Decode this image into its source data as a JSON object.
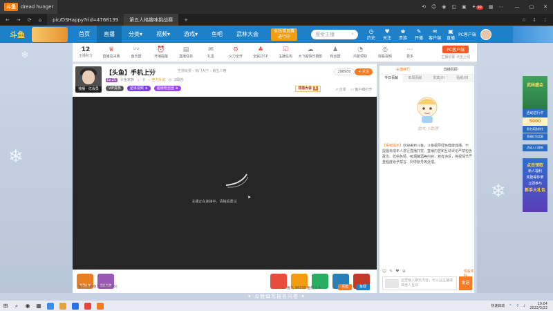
{
  "browser": {
    "tab_logo": "斗鱼",
    "tab_title": "dread hunger",
    "url_text": "pic/DSHappy?rid=4768139",
    "tab2_title": "第五人格趣味挑战赛",
    "nav_icons": [
      "←",
      "→",
      "⟳",
      "⌂"
    ],
    "top_icons": [
      "⟲",
      "☺",
      "◉",
      "◫",
      "▣",
      "✦",
      "▦",
      "⋯"
    ],
    "top_badge": "99",
    "win_controls": [
      "—",
      "▢",
      "✕"
    ],
    "addr_icons": [
      "☆",
      "⇩",
      "⋮"
    ]
  },
  "site": {
    "logo": "斗鱼",
    "menu": [
      "首页",
      "直播",
      "分类▾",
      "视频▾",
      "游戏▾",
      "鱼吧",
      "武林大会"
    ],
    "active_menu_index": 1,
    "promo": "全站首页赛",
    "promo_sub": "进行中",
    "search_placeholder": "搜索主播",
    "search_icon": "⌕",
    "icons": [
      {
        "glyph": "◷",
        "label": "历史"
      },
      {
        "glyph": "♥",
        "label": "关注"
      },
      {
        "glyph": "♚",
        "label": "贵族"
      },
      {
        "glyph": "✎",
        "label": "开播"
      },
      {
        "glyph": "✉",
        "label": "客户端"
      },
      {
        "glyph": "▣",
        "label": "直播"
      }
    ],
    "pc_client": "PC客户端"
  },
  "toolbar": {
    "count": "12",
    "count_label": "主播积分",
    "items": [
      {
        "glyph": "♛",
        "label": "直播总决赛"
      },
      {
        "glyph": "〰",
        "label": "鱼乐团"
      },
      {
        "glyph": "⏰",
        "label": "开播提醒"
      },
      {
        "glyph": "▤",
        "label": "直播任务"
      },
      {
        "glyph": "✉",
        "label": "礼盒"
      },
      {
        "glyph": "⚙",
        "label": "火力全开"
      },
      {
        "glyph": "♣",
        "label": "全民打CP"
      },
      {
        "glyph": "☑",
        "label": "主播任务"
      },
      {
        "glyph": "☁",
        "label": "大飞船快乐摄影"
      },
      {
        "glyph": "♟",
        "label": "粉丝团"
      },
      {
        "glyph": "◔",
        "label": "鸿蒙领取"
      },
      {
        "glyph": "◎",
        "label": "观看视频"
      },
      {
        "glyph": "⋯",
        "label": "更多"
      }
    ],
    "pc_button": "PC客户端",
    "pc_sub": "主播招募 点击上线"
  },
  "room": {
    "avatar_label": "独播 · 亿会员",
    "title": "【头鱼】手机上分",
    "report": "举报",
    "crumb": "生游玩耍 › 热门大厅 › 第五人格",
    "level": "LV.25",
    "level_name": "头鱼家族",
    "heat": "0",
    "tag": "✓ 官方认证",
    "followers_label": "2周前",
    "pill1": "VIP贵族",
    "pill2": "星级视频 ★",
    "pill3": "超级粉丝团 ★",
    "follow_count": "298930",
    "follow_btn": "+ 关注",
    "hunt_label": "寻猎大会",
    "hunt_num": "1",
    "share": "⇗ 分享",
    "client_play": "▭ 客户端打开",
    "video_msg": "主播正在连接中，请稍后重试",
    "yuchi": "鱼丸 当前鱼丸已满(0/50)",
    "stats": "鱼丸 96230   鱼翅 1.4",
    "recharge": "充值",
    "pay": "鱼翅"
  },
  "gifts": [
    {
      "label": "免费礼物",
      "color": "#e67e22"
    },
    {
      "label": "粉丝礼物",
      "color": "#9b59b6"
    },
    {
      "label": "",
      "color": "#e74c3c"
    },
    {
      "label": "",
      "color": "#f39c12"
    },
    {
      "label": "",
      "color": "#27ae60"
    },
    {
      "label": "",
      "color": "#2980b9"
    },
    {
      "label": "",
      "color": "#c0392b"
    }
  ],
  "chat": {
    "tabs1": [
      "主播排行",
      "直播回顾"
    ],
    "tabs2": [
      "今日贡献",
      "本周贡献",
      "贵宾(0)",
      "贴纸(0)"
    ],
    "mascot_text": "鱼丸小助理",
    "sys_title": "【系统提示】",
    "sys_body": "欢迎来到斗鱼，斗鱼倡导绿色健康直播，不提倡未成年人进行直播打赏。直播内容和互动评论严禁包含政治、低俗色情、吸烟酗酒等内容，若有违反，将视情节严重程度给予禁言、封停账号等处理。",
    "icons": [
      "☺",
      "✎",
      "♥",
      "⊕"
    ],
    "right_label": "观看奖励",
    "input_placeholder": "这里输入聊天内容，可以@主播或其他人互动",
    "send": "发送"
  },
  "side_ads": {
    "ad1_title": "武林盛会",
    "ad1_b": "活动进行中",
    "ad1_c": "5000",
    "ad1_d": "报名奖励前往",
    "ad1_e": "鱼翅红包奖励",
    "ad1_f": "活动入口规则",
    "ad2_lines": [
      "点击领取",
      "新人福利",
      "奖励等你拿",
      "立即参与",
      "新手大礼包"
    ]
  },
  "bottom_banner": "✶ 点我填写报名问卷 ✶",
  "taskbar": {
    "icons": [
      "⊞",
      "⌕",
      "◉",
      "▦"
    ],
    "apps": [
      "#3b8ee8",
      "#e8a23b",
      "#2a6ee8",
      "#e8443b",
      "#f57a22"
    ],
    "right_text": "快速启动",
    "time": "19:04",
    "date": "2022/3/22"
  }
}
